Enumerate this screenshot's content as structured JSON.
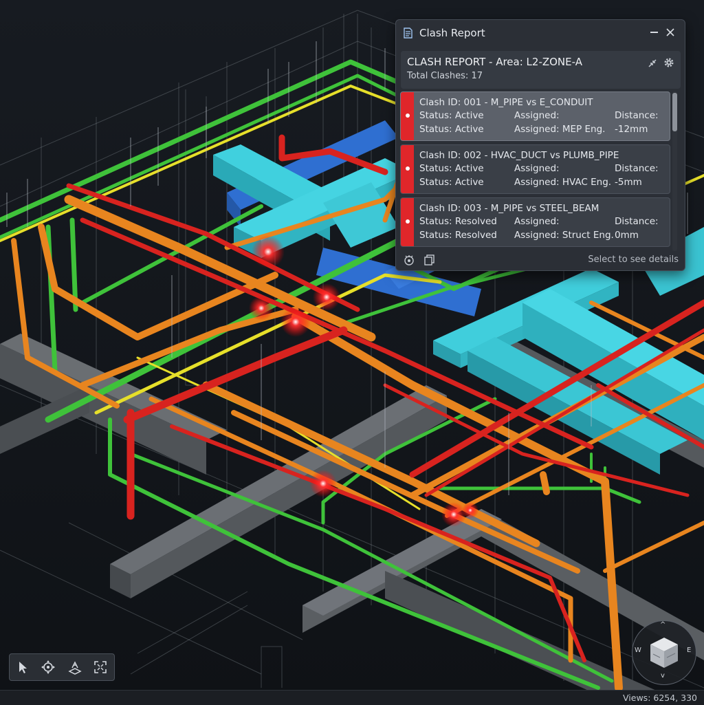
{
  "window": {
    "title": "Clash Report"
  },
  "report": {
    "heading": "CLASH REPORT - Area: L2-ZONE-A",
    "total": "Total Clashes: 17",
    "clashes": [
      {
        "id": "Clash ID: 001 - M_PIPE vs E_CONDUIT",
        "status_a": "Status: Active",
        "assigned_a": "Assigned:",
        "distance_a": "Distance:",
        "status_b": "Status:  Active",
        "assigned_b": "Assigned: MEP Eng.",
        "distance_b": "-12mm",
        "selected": true
      },
      {
        "id": "Clash ID: 002 - HVAC_DUCT vs PLUMB_PIPE",
        "status_a": "Status: Active",
        "assigned_a": "Assigned:",
        "distance_a": "Distance:",
        "status_b": "Status:  Active",
        "assigned_b": "Assigned: HVAC Eng.",
        "distance_b": "-5mm",
        "selected": false
      },
      {
        "id": "Clash ID: 003 - M_PIPE vs STEEL_BEAM",
        "status_a": "Status: Resolved",
        "assigned_a": "Assigned:",
        "distance_a": "Distance:",
        "status_b": "Status:  Resolved",
        "assigned_b": "Assigned: Struct Eng.",
        "distance_b": "0mm",
        "selected": false
      }
    ],
    "footer_hint": "Select to see details"
  },
  "viewcube": {
    "north": "^",
    "south": "v",
    "west": "W",
    "east": "E"
  },
  "statusbar": {
    "views": "Views: 6254, 330"
  },
  "colors": {
    "hvac_duct": "#35c2d1",
    "duct_blue": "#2f6fd1",
    "pipe_orange": "#e8851f",
    "pipe_red": "#d8231f",
    "pipe_green": "#3fc23a",
    "conduit_yellow": "#e6df2a",
    "steel_beam": "#5b5f63",
    "clash_marker": "#ff2a2a"
  }
}
